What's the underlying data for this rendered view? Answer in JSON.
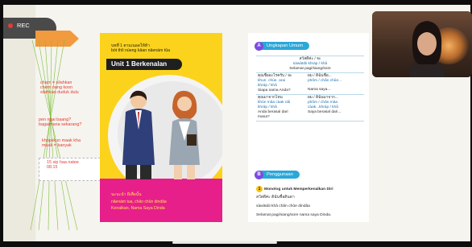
{
  "recording": {
    "label": "REC",
    "dot_color": "#e53935"
  },
  "notes": [
    "charn = silahkan\nchern nang koon\nsilahkan duduk dulu",
    "pen ngai baang?\nbagaimana sekarang?",
    "khopkkun maak kha\nmaak = banyak"
  ],
  "note_box_text": "15 sip haa natee\n08.15",
  "cover": {
    "sub1": "บทที่ 1 ตามเนอดให้ท้า",
    "sub2": "bòt thîi nùeng kâan nâenám tûa",
    "unit_title": "Unit 1 Berkenalan",
    "bottom1": "นะนะนำ ผีเพื่อนั้น",
    "bottom2": "nâenám tua, chân chûn dindâa",
    "bottom3": "Kenalkan, Nama Saya Dinda"
  },
  "page": {
    "sec_a_num": "A",
    "sec_a_label": "Ungkapan Umum",
    "table": {
      "r1_thai": "สวัสดีค่ะ / จะ",
      "r1_tl": "sàwàtdii khráp / khâ",
      "r1_id": "Selamat pagi/siang/sore",
      "r2_c1_thai": "คุณชื่ออะไรครับ / จะ",
      "r2_c1_tl": "khun  chûe  arai\nkhráp / khâ",
      "r2_c2_thai": "ผม / ดิฉันชื่อ...",
      "r2_c2_tl": "phǒm / chǎn chûe...",
      "r2_c1_id": "Siapa nama Anda?",
      "r2_c2_id": "Nama saya...",
      "r3_c1_thai": "คุณมาจากไหน",
      "r3_c1_tl": "khûn mâa càak nǎi\nkhráp / khâ",
      "r3_c2_thai": "ผม / ดิฉันมาจาก...",
      "r3_c2_tl": "phǒm / chǎn mâa\ncàak...khráp / khâ",
      "r3_c1_id": "Anda berasal dari\nmana?",
      "r3_c2_id": "Saya berasal dari..."
    },
    "sec_b_num": "B",
    "sec_b_label": "Penggunaan",
    "mono_num": "1",
    "mono_title": "Monolog untuk Memperkenalkan Diri",
    "mono_thai": "สวัสดีค่ะ ดิฉันชื่อดินดา",
    "mono_tl": "sàwàtdii khâ chǎn chûe dindâa",
    "mono_id": "Selamat pagi/siang/sore nama saya Dinda."
  },
  "colors": {
    "cover_yellow": "#fbd31c",
    "cover_magenta": "#e61f8b",
    "section_blue": "#2ba7d8",
    "section_purple": "#7b4be0",
    "note_red": "#e53935",
    "arrow_orange": "#f19a3e"
  },
  "icons": [
    "record-dot-icon",
    "orange-arrow-icon",
    "webcam-participant"
  ]
}
